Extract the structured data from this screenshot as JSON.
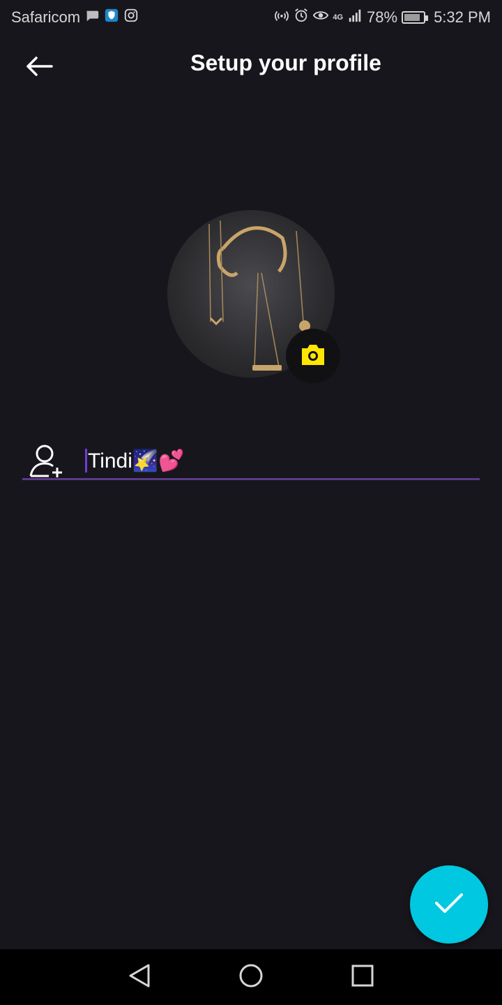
{
  "status_bar": {
    "carrier": "Safaricom",
    "battery": "78%",
    "time": "5:32 PM",
    "network": "4G",
    "icons": [
      "message-icon",
      "shield-icon",
      "instagram-icon",
      "hotspot-icon",
      "alarm-icon",
      "eye-icon",
      "signal-icon",
      "battery-icon"
    ]
  },
  "header": {
    "title": "Setup your profile",
    "back_icon": "arrow-left-icon"
  },
  "profile": {
    "camera_icon": "camera-icon",
    "camera_color": "#ffe600"
  },
  "name_field": {
    "value": "Tindi🌠💕",
    "icon": "person-add-icon",
    "underline_color": "#5b3a8c"
  },
  "fab": {
    "icon": "check-icon",
    "color": "#00c8e0"
  },
  "nav": {
    "back": "triangle-back-icon",
    "home": "circle-home-icon",
    "recents": "square-recents-icon"
  }
}
